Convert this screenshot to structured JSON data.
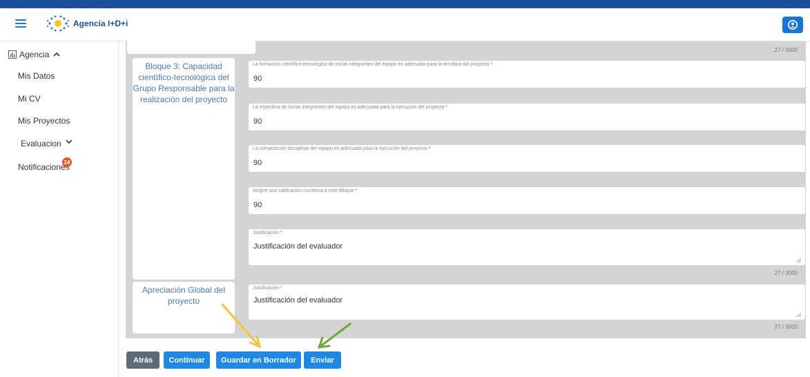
{
  "header": {
    "app_name": "Agencia I+D+i"
  },
  "sidebar": {
    "agencia_label": "Agencia",
    "items": [
      {
        "label": "Mis Datos"
      },
      {
        "label": "Mi CV"
      },
      {
        "label": "Mis Proyectos"
      },
      {
        "label": "Evaluacion"
      },
      {
        "label": "Notificaciones"
      }
    ],
    "notifications_badge": "24"
  },
  "blocks": {
    "top_counter": "27 / 3000",
    "bloque3": {
      "title": "Bloque 3: Capacidad científico-tecnológica del Grupo Responsable para la realización del proyecto",
      "fields": [
        {
          "label": "La formación científico-tecnológica de los/as integrantes del equipo es adecuada para la temática del proyecto",
          "value": "90"
        },
        {
          "label": "La experticia de los/as integrantes del equipo es adecuada para la ejecución del proyecto",
          "value": "90"
        },
        {
          "label": "La composición disciplinar del equipo es adecuada para la ejecución del proyecto",
          "value": "90"
        },
        {
          "label": "Asigne una calificación numérica a este Bloque",
          "value": "90"
        }
      ],
      "justificacion_label": "Justificación",
      "justificacion_value": "Justificación del evaluador",
      "counter": "27 / 3000"
    },
    "global": {
      "title": "Apreciación Global del proyecto",
      "justificacion_label": "Justificación",
      "justificacion_value": "Justificación del evaluador",
      "counter": "27 / 3000"
    }
  },
  "actions": {
    "back": "Atrás",
    "continue": "Continuar",
    "save_draft": "Guardar en Borrador",
    "send": "Enviar"
  },
  "colors": {
    "primary": "#1e88e5",
    "back_button": "#5b6b79",
    "badge": "#e8542b",
    "arrow_yellow": "#f5c23b",
    "arrow_green": "#6aaa3c"
  }
}
